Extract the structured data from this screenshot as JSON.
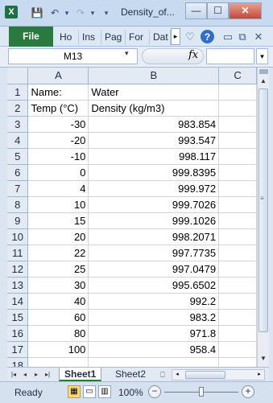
{
  "window": {
    "app_icon_letter": "X",
    "title": "Density_of...",
    "minimize": "—",
    "maximize": "☐",
    "close": "✕"
  },
  "qat": {
    "save": "💾",
    "undo": "↶",
    "redo": "↷",
    "customize": "▾"
  },
  "ribbon": {
    "file_label": "File",
    "tabs": [
      "Ho",
      "Ins",
      "Pag",
      "For",
      "Dat"
    ],
    "more_arrow": "▸",
    "icons": {
      "heart": "♡",
      "help": "?",
      "minimize": "▭",
      "restore": "⧉",
      "close": "✕"
    }
  },
  "formula_bar": {
    "name_box": "M13",
    "name_box_arrow": "▾",
    "fx": "fx",
    "formula": "",
    "expand": "▾"
  },
  "sheet": {
    "col_headers": [
      "A",
      "B",
      "C"
    ],
    "rows": [
      {
        "n": "1",
        "a": "Name:",
        "b": "Water",
        "a_align": "txt",
        "b_align": "txt"
      },
      {
        "n": "2",
        "a": "Temp (°C)",
        "b": "Density (kg/m3)",
        "a_align": "txt",
        "b_align": "txt"
      },
      {
        "n": "3",
        "a": "-30",
        "b": "983.854"
      },
      {
        "n": "4",
        "a": "-20",
        "b": "993.547"
      },
      {
        "n": "5",
        "a": "-10",
        "b": "998.117"
      },
      {
        "n": "6",
        "a": "0",
        "b": "999.8395"
      },
      {
        "n": "7",
        "a": "4",
        "b": "999.972"
      },
      {
        "n": "8",
        "a": "10",
        "b": "999.7026"
      },
      {
        "n": "9",
        "a": "15",
        "b": "999.1026"
      },
      {
        "n": "10",
        "a": "20",
        "b": "998.2071"
      },
      {
        "n": "11",
        "a": "22",
        "b": "997.7735"
      },
      {
        "n": "12",
        "a": "25",
        "b": "997.0479"
      },
      {
        "n": "13",
        "a": "30",
        "b": "995.6502"
      },
      {
        "n": "14",
        "a": "40",
        "b": "992.2"
      },
      {
        "n": "15",
        "a": "60",
        "b": "983.2"
      },
      {
        "n": "16",
        "a": "80",
        "b": "971.8"
      },
      {
        "n": "17",
        "a": "100",
        "b": "958.4"
      },
      {
        "n": "18",
        "a": "",
        "b": ""
      }
    ]
  },
  "scroll": {
    "up": "▲",
    "down": "▼",
    "left": "◂",
    "right": "▸",
    "grip": "≡"
  },
  "sheet_tabs": {
    "nav": [
      "|◂",
      "◂",
      "▸",
      "▸|"
    ],
    "tabs": [
      "Sheet1",
      "Sheet2"
    ],
    "insert": "⎕"
  },
  "status": {
    "text": "Ready",
    "zoom": "100%",
    "zoom_out": "−",
    "zoom_in": "+"
  }
}
